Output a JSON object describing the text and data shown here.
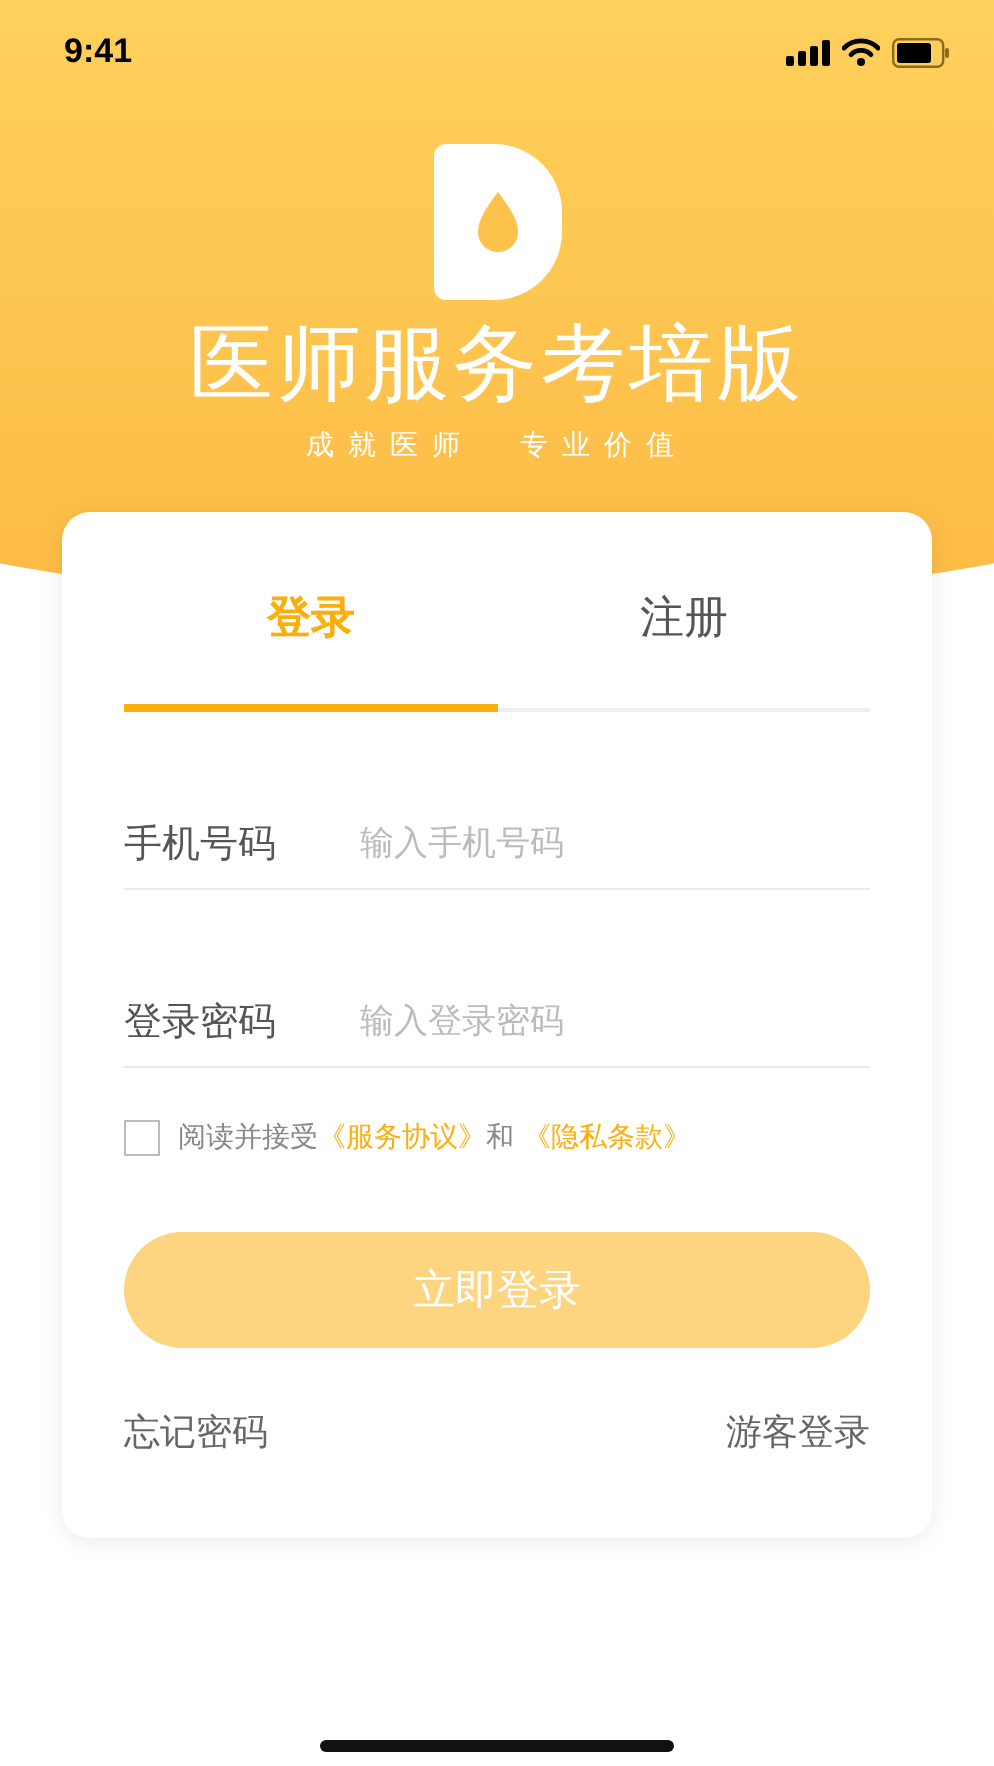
{
  "status_bar": {
    "time": "9:41"
  },
  "header": {
    "title": "医师服务考培版",
    "slogan": "成就医师  专业价值"
  },
  "tabs": [
    {
      "label": "登录",
      "selected": true
    },
    {
      "label": "注册",
      "selected": false
    }
  ],
  "fields": [
    {
      "label": "手机号码",
      "placeholder": "输入手机号码"
    },
    {
      "label": "登录密码",
      "placeholder": "输入登录密码"
    }
  ],
  "agreement": {
    "checked": false,
    "prefix": "阅读并接受",
    "links": [
      "《服务协议》",
      "《隐私条款》"
    ],
    "joiner": "和"
  },
  "login_button": {
    "label": "立即登录",
    "disabled": true
  },
  "footer_links": [
    "忘记密码",
    "游客登录"
  ]
}
